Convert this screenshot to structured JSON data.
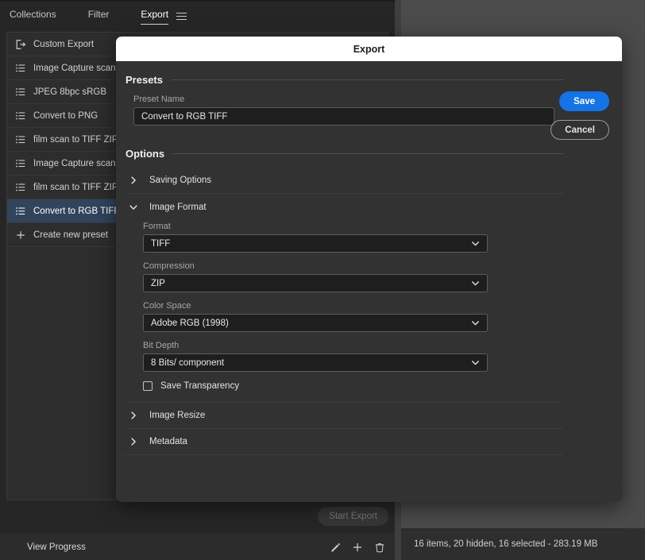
{
  "app": {
    "tabs": [
      {
        "label": "Collections",
        "active": false
      },
      {
        "label": "Filter",
        "active": false
      },
      {
        "label": "Export",
        "active": true
      }
    ],
    "menu_icon": "hamburger-icon"
  },
  "presets_panel": {
    "items": [
      {
        "label": "Custom Export",
        "icon": "export-arrow-icon",
        "selected": false
      },
      {
        "label": "Image Capture scan to",
        "icon": "list-icon",
        "selected": false
      },
      {
        "label": "JPEG 8bpc sRGB",
        "icon": "list-icon",
        "selected": false
      },
      {
        "label": "Convert to PNG",
        "icon": "list-icon",
        "selected": false
      },
      {
        "label": "film scan to TIFF ZIP co",
        "icon": "list-icon",
        "selected": false
      },
      {
        "label": "Image Capture scan to",
        "icon": "list-icon",
        "selected": false
      },
      {
        "label": "film scan to TIFF ZIP gr",
        "icon": "list-icon",
        "selected": false
      },
      {
        "label": "Convert to RGB TIFF",
        "icon": "list-icon",
        "selected": true
      },
      {
        "label": "Create new preset",
        "icon": "plus-icon",
        "selected": false
      }
    ]
  },
  "footer": {
    "start_export_label": "Start Export",
    "view_progress_label": "View Progress",
    "icons": [
      {
        "name": "pencil-icon"
      },
      {
        "name": "plus-icon"
      },
      {
        "name": "trash-icon"
      }
    ]
  },
  "status": {
    "text": "16 items, 20 hidden, 16 selected - 283.19 MB"
  },
  "dialog": {
    "title": "Export",
    "buttons": {
      "save": "Save",
      "cancel": "Cancel"
    },
    "presets_section": {
      "title": "Presets",
      "preset_name_label": "Preset Name",
      "preset_name_value": "Convert to RGB TIFF",
      "preset_name_placeholder": "Preset Name"
    },
    "options_section": {
      "title": "Options",
      "groups": [
        {
          "label": "Saving Options",
          "expanded": false,
          "icon": "chevron-right-icon"
        },
        {
          "label": "Image Format",
          "expanded": true,
          "icon": "chevron-down-icon"
        },
        {
          "label": "Image Resize",
          "expanded": false,
          "icon": "chevron-right-icon"
        },
        {
          "label": "Metadata",
          "expanded": false,
          "icon": "chevron-right-icon"
        }
      ],
      "image_format": {
        "format_label": "Format",
        "format_value": "TIFF",
        "compression_label": "Compression",
        "compression_value": "ZIP",
        "color_space_label": "Color Space",
        "color_space_value": "Adobe RGB (1998)",
        "bit_depth_label": "Bit Depth",
        "bit_depth_value": "8 Bits/ component",
        "save_transparency_label": "Save Transparency",
        "save_transparency_checked": false
      }
    }
  },
  "colors": {
    "accent": "#1473e6",
    "selection": "#31445c",
    "panel_bg": "#262626",
    "dialog_bg": "#323232",
    "titlebar_bg": "#ffffff"
  }
}
